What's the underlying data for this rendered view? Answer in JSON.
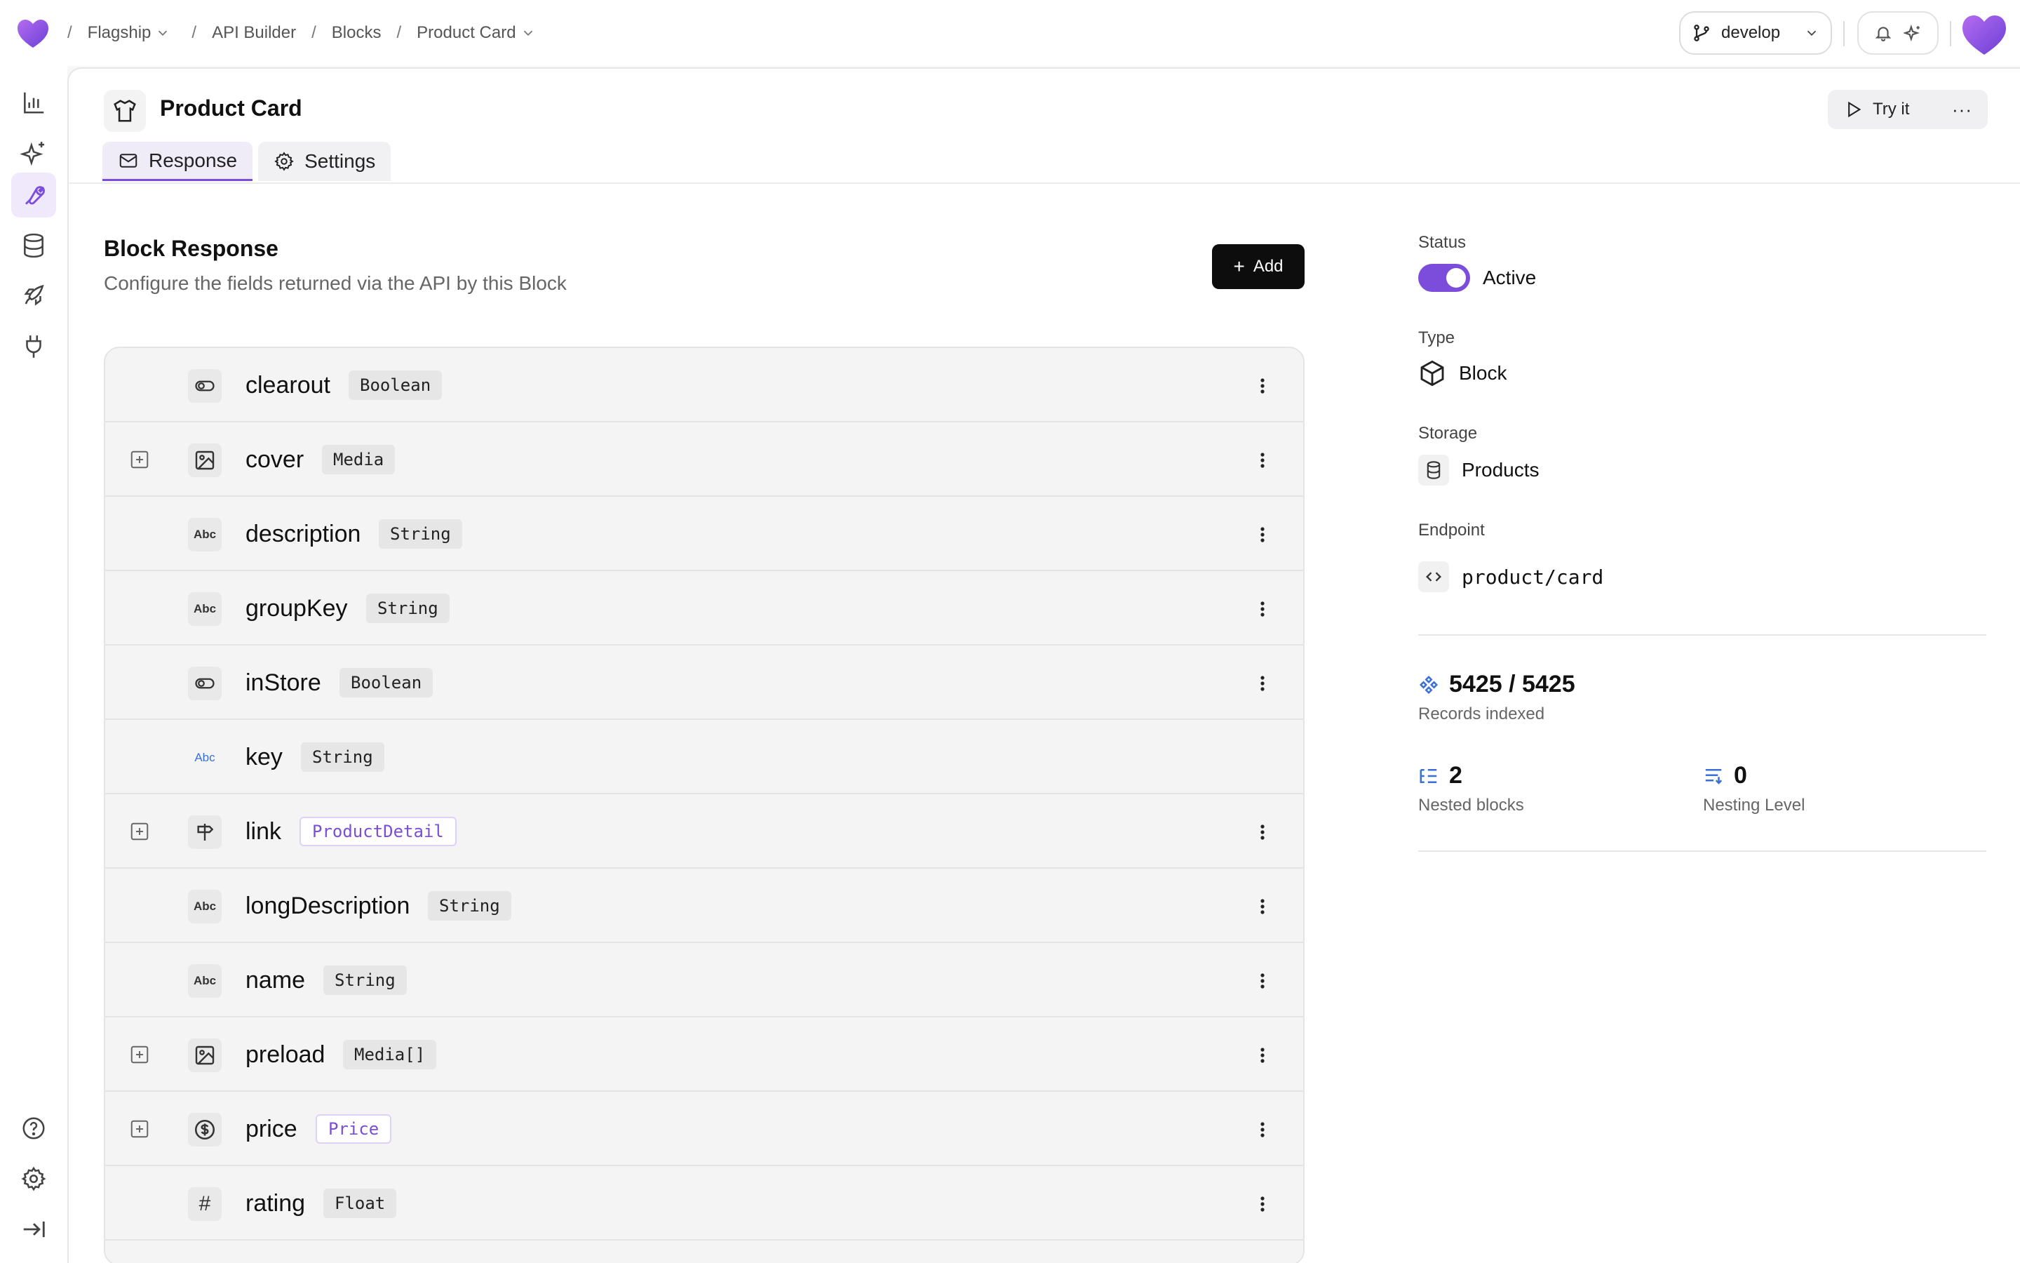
{
  "topbar": {
    "breadcrumb": [
      "Flagship",
      "API Builder",
      "Blocks",
      "Product Card"
    ],
    "branch": "develop",
    "accent": "#7c4ddb"
  },
  "sidebar": {
    "items": [
      {
        "icon": "bar-chart-icon",
        "active": false
      },
      {
        "icon": "sparkles-icon",
        "active": false
      },
      {
        "icon": "wrench-icon",
        "active": true
      },
      {
        "icon": "database-icon",
        "active": false
      },
      {
        "icon": "rocket-icon",
        "active": false
      },
      {
        "icon": "plug-icon",
        "active": false
      }
    ],
    "bottom": [
      "help-icon",
      "gear-icon",
      "collapse-icon"
    ]
  },
  "page": {
    "title": "Product Card",
    "try_label": "Try it",
    "more_label": "···",
    "tabs": [
      {
        "label": "Response",
        "icon": "envelope-icon",
        "active": true
      },
      {
        "label": "Settings",
        "icon": "gear-icon",
        "active": false
      }
    ]
  },
  "section": {
    "title": "Block Response",
    "subtitle": "Configure the fields returned via the API by this Block",
    "add_label": "Add",
    "add_symbol": "+"
  },
  "fields": [
    {
      "name": "clearout",
      "type": "Boolean",
      "icon": "toggle-icon",
      "glyph": "",
      "expandable": false,
      "typeStyle": "plain",
      "menu": true
    },
    {
      "name": "cover",
      "type": "Media",
      "icon": "image-icon",
      "glyph": "",
      "expandable": true,
      "typeStyle": "plain",
      "menu": true
    },
    {
      "name": "description",
      "type": "String",
      "icon": "text-icon",
      "glyph": "Abc",
      "expandable": false,
      "typeStyle": "plain",
      "menu": true
    },
    {
      "name": "groupKey",
      "type": "String",
      "icon": "text-icon",
      "glyph": "Abc",
      "expandable": false,
      "typeStyle": "plain",
      "menu": true
    },
    {
      "name": "inStore",
      "type": "Boolean",
      "icon": "toggle-icon",
      "glyph": "",
      "expandable": false,
      "typeStyle": "plain",
      "menu": true
    },
    {
      "name": "key",
      "type": "String",
      "icon": "text-icon",
      "glyph": "Abc",
      "expandable": false,
      "typeStyle": "plain",
      "menu": false,
      "iconBlue": true
    },
    {
      "name": "link",
      "type": "ProductDetail",
      "icon": "signpost-icon",
      "glyph": "",
      "expandable": true,
      "typeStyle": "purple",
      "menu": true
    },
    {
      "name": "longDescription",
      "type": "String",
      "icon": "text-icon",
      "glyph": "Abc",
      "expandable": false,
      "typeStyle": "plain",
      "menu": true
    },
    {
      "name": "name",
      "type": "String",
      "icon": "text-icon",
      "glyph": "Abc",
      "expandable": false,
      "typeStyle": "plain",
      "menu": true
    },
    {
      "name": "preload",
      "type": "Media[]",
      "icon": "image-icon",
      "glyph": "",
      "expandable": true,
      "typeStyle": "plain",
      "menu": true
    },
    {
      "name": "price",
      "type": "Price",
      "icon": "dollar-icon",
      "glyph": "",
      "expandable": true,
      "typeStyle": "purple",
      "menu": true
    },
    {
      "name": "rating",
      "type": "Float",
      "icon": "hash-icon",
      "glyph": "#",
      "expandable": false,
      "typeStyle": "plain",
      "menu": true
    }
  ],
  "details": {
    "status_label": "Status",
    "status_value": "Active",
    "type_label": "Type",
    "type_value": "Block",
    "storage_label": "Storage",
    "storage_value": "Products",
    "endpoint_label": "Endpoint",
    "endpoint_value": "product/card",
    "records_value": "5425 / 5425",
    "records_caption": "Records indexed",
    "nested_value": "2",
    "nested_caption": "Nested blocks",
    "level_value": "0",
    "level_caption": "Nesting Level"
  }
}
